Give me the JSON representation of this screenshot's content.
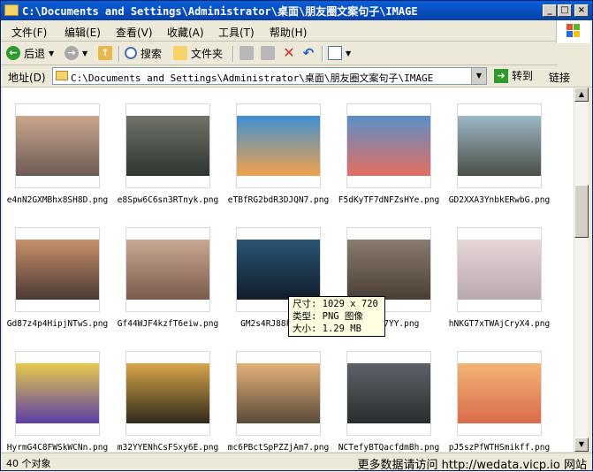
{
  "window": {
    "title": "C:\\Documents and Settings\\Administrator\\桌面\\朋友圈文案句子\\IMAGE",
    "controls": [
      "_",
      "□",
      "×"
    ]
  },
  "menu": [
    "文件(F)",
    "编辑(E)",
    "查看(V)",
    "收藏(A)",
    "工具(T)",
    "帮助(H)"
  ],
  "toolbar": {
    "back": "后退",
    "search": "搜索",
    "folders": "文件夹",
    "icons": {
      "back": "back-arrow-icon",
      "forward": "forward-arrow-icon",
      "up": "up-folder-icon",
      "search": "search-icon",
      "folders": "folders-icon",
      "move": "move-to-icon",
      "copy": "copy-to-icon",
      "delete": "delete-icon",
      "undo": "undo-icon",
      "views": "views-icon"
    }
  },
  "address": {
    "label": "地址(D)",
    "path": "C:\\Documents and Settings\\Administrator\\桌面\\朋友圈文案句子\\IMAGE",
    "go": "转到",
    "links": "链接"
  },
  "files": [
    {
      "name": "e4nN2GXMBhx8SH8D.png",
      "c1": "#C9A68C",
      "c2": "#6F5A55"
    },
    {
      "name": "e8Spw6C6sn3RTnyk.png",
      "c1": "#6E7468",
      "c2": "#2F3530"
    },
    {
      "name": "eTBfRG2bdR3DJQN7.png",
      "c1": "#3F8FD2",
      "c2": "#F2A24A"
    },
    {
      "name": "F5dKyTF7dNFZsHYe.png",
      "c1": "#5A8FC7",
      "c2": "#E56E62"
    },
    {
      "name": "GD2XXA3YnbkERwbG.png",
      "c1": "#9CB7C5",
      "c2": "#4B4F47"
    },
    {
      "name": "Gd87z4p4HipjNTwS.png",
      "c1": "#C9906A",
      "c2": "#4A3A34"
    },
    {
      "name": "Gf44WJF4kzfT6eiw.png",
      "c1": "#C9A894",
      "c2": "#7A5A4A"
    },
    {
      "name": "GM2s4RJ88kt.png",
      "c1": "#2C5576",
      "c2": "#101D2A"
    },
    {
      "name": "MfDSp7YY.png",
      "c1": "#8A7C6E",
      "c2": "#4A3E34"
    },
    {
      "name": "hNKGT7xTWAjCryX4.png",
      "c1": "#E7D6D6",
      "c2": "#B9A7B0"
    },
    {
      "name": "HyrmG4C8FWSkWCNn.png",
      "c1": "#E8C94A",
      "c2": "#5A3EA8"
    },
    {
      "name": "m32YYENhCsFSxy6E.png",
      "c1": "#D9A54A",
      "c2": "#2E2A1A"
    },
    {
      "name": "mc6PBctSpPZZjAm7.png",
      "c1": "#E3B27A",
      "c2": "#5A4A3A"
    },
    {
      "name": "NCTefyBTQacfdmBh.png",
      "c1": "#5C6268",
      "c2": "#2A2E32"
    },
    {
      "name": "pJ5szPfWTHSmikff.png",
      "c1": "#F3B574",
      "c2": "#D96A4A"
    }
  ],
  "tooltip": {
    "size": "尺寸: 1029 x 720",
    "type": "类型: PNG 图像",
    "bytes": "大小: 1.29 MB"
  },
  "status": {
    "count": "40 个对象",
    "site": "更多数据请访问 http://wedata.vicp.io 网站"
  }
}
